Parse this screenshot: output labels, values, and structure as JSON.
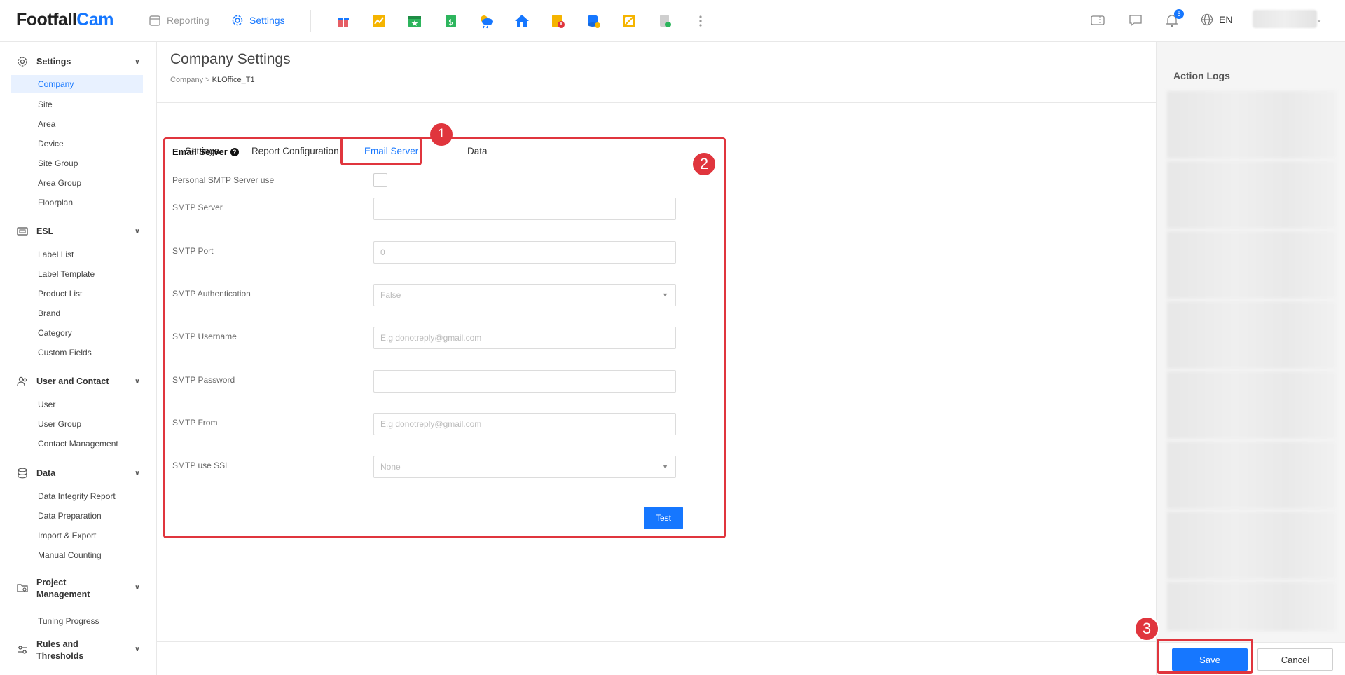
{
  "brand": {
    "name_part1": "Footfall",
    "name_part2": "Cam"
  },
  "topnav": {
    "reporting": "Reporting",
    "settings": "Settings",
    "language": "EN",
    "notification_count": "5"
  },
  "sidebar": {
    "groups": [
      {
        "label": "Settings",
        "items": [
          "Company",
          "Site",
          "Area",
          "Device",
          "Site Group",
          "Area Group",
          "Floorplan"
        ]
      },
      {
        "label": "ESL",
        "items": [
          "Label List",
          "Label Template",
          "Product List",
          "Brand",
          "Category",
          "Custom Fields"
        ]
      },
      {
        "label": "User and Contact",
        "items": [
          "User",
          "User Group",
          "Contact Management"
        ]
      },
      {
        "label": "Data",
        "items": [
          "Data Integrity Report",
          "Data Preparation",
          "Import & Export",
          "Manual Counting"
        ]
      },
      {
        "label_line1": "Project",
        "label_line2": "Management",
        "items": [
          "Tuning Progress"
        ]
      },
      {
        "label_line1": "Rules and",
        "label_line2": "Thresholds",
        "items": []
      }
    ]
  },
  "page": {
    "title": "Company Settings",
    "breadcrumb_root": "Company",
    "breadcrumb_sep": ">",
    "breadcrumb_current": "KLOffice_T1",
    "tabs": [
      "Settings",
      "Report Configuration",
      "Email Server",
      "Data"
    ],
    "active_tab": "Email Server"
  },
  "form": {
    "section_title": "Email Server",
    "help_glyph": "?",
    "fields": {
      "personal_smtp": {
        "label": "Personal SMTP Server use",
        "checked": false
      },
      "server": {
        "label": "SMTP Server",
        "value": ""
      },
      "port": {
        "label": "SMTP Port",
        "value": "0"
      },
      "auth": {
        "label": "SMTP Authentication",
        "value": "False"
      },
      "username": {
        "label": "SMTP Username",
        "placeholder": "E.g donotreply@gmail.com"
      },
      "password": {
        "label": "SMTP Password",
        "value": ""
      },
      "from": {
        "label": "SMTP From",
        "placeholder": "E.g donotreply@gmail.com"
      },
      "ssl": {
        "label": "SMTP use SSL",
        "value": "None"
      }
    },
    "test_label": "Test"
  },
  "right_panel": {
    "title": "Action Logs",
    "save_label": "Save",
    "cancel_label": "Cancel"
  },
  "annotations": [
    "1",
    "2",
    "3"
  ],
  "colors": {
    "accent": "#1677ff",
    "highlight": "#e0353d",
    "active_bg": "#e8f1ff"
  },
  "icons": [
    "calendar-icon",
    "gear-icon",
    "gift-icon",
    "chart-icon",
    "star-calendar-icon",
    "dollar-doc-icon",
    "weather-icon",
    "home-icon",
    "doc-alert-icon",
    "database-icon",
    "polygon-icon",
    "report-icon",
    "more-icon",
    "ticket-icon",
    "chat-icon",
    "bell-icon",
    "globe-icon"
  ]
}
